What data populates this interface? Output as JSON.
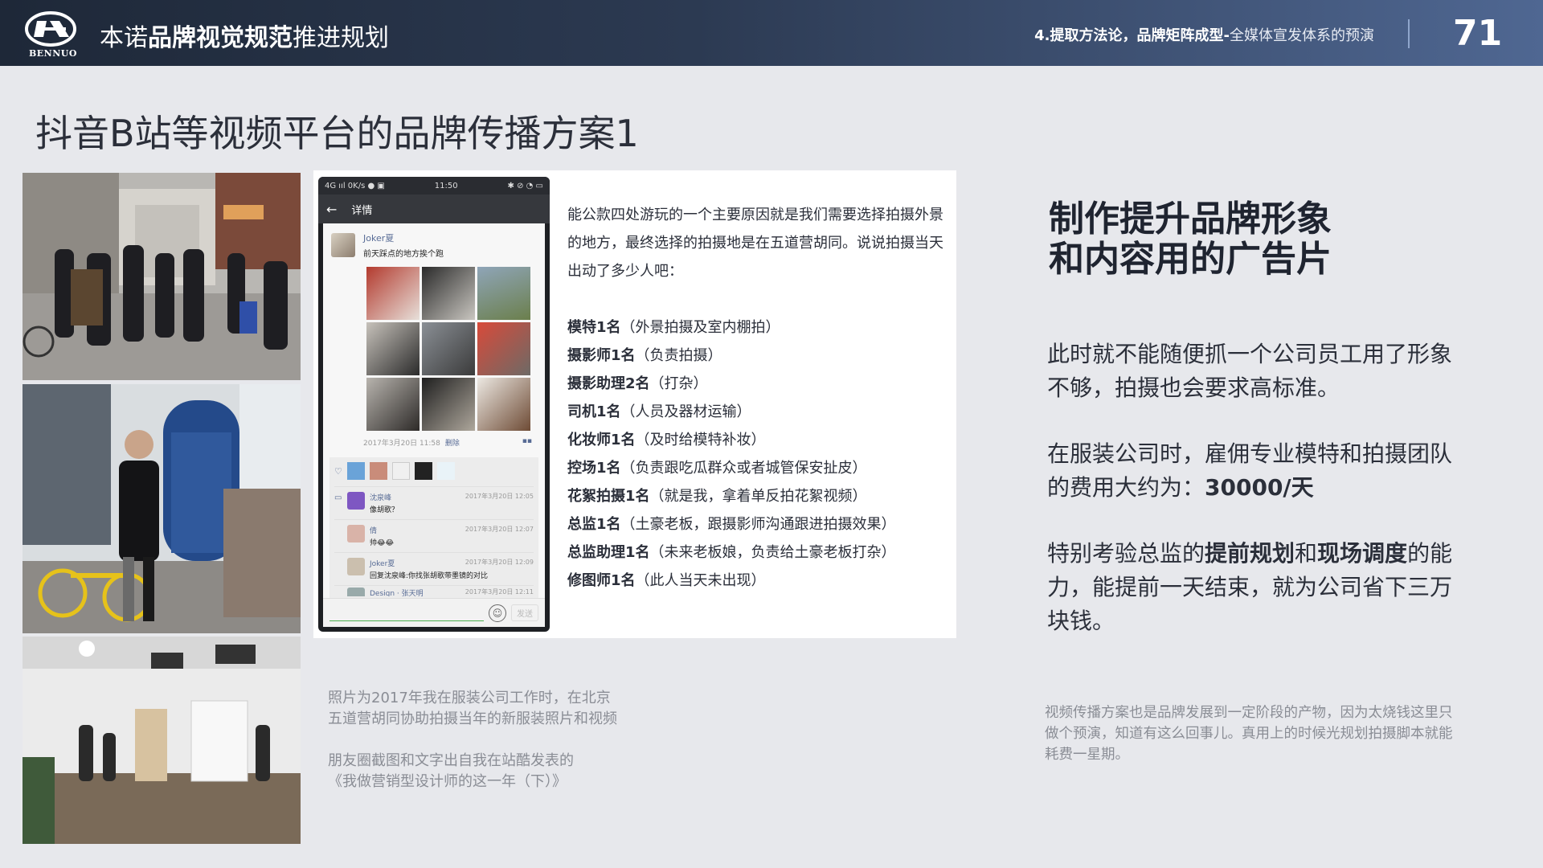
{
  "header": {
    "logo_text": "BENNUO",
    "title_prefix": "本诺",
    "title_bold": "品牌视觉规范",
    "title_suffix": "推进规划",
    "section_bold": "4.提取方法论，品牌矩阵成型-",
    "section_rest": "全媒体宣发体系的预演",
    "page_number": "71"
  },
  "page_title": "抖音B站等视频平台的品牌传播方案1",
  "phone": {
    "status_left": "4G ııl  0K/s ● ▣",
    "status_time": "11:50",
    "status_right": "✱ ⊘ ◔ ▭",
    "nav_title": "详情",
    "post_name": "Joker夏",
    "post_text": "前天踩点的地方挨个跑",
    "post_time": "2017年3月20日 11:58",
    "post_delete": "删除",
    "comments": [
      {
        "name": "沈泉峰",
        "text": "像胡歌？",
        "time": "2017年3月20日 12:05"
      },
      {
        "name": "倩",
        "text": "帅😂😂",
        "time": "2017年3月20日 12:07"
      },
      {
        "name": "Joker夏",
        "text": "回复沈泉峰:你找张胡歌带墨镜的对比",
        "time": "2017年3月20日 12:09"
      },
      {
        "name": "Design · 张天明",
        "text": "",
        "time": "2017年3月20日 12:11"
      }
    ],
    "send_label": "发送"
  },
  "story": {
    "intro": "能公款四处游玩的一个主要原因就是我们需要选择拍摄外景的地方，最终选择的拍摄地是在五道营胡同。说说拍摄当天出动了多少人吧：",
    "roles": [
      {
        "role": "模特1名",
        "note": "（外景拍摄及室内棚拍）"
      },
      {
        "role": "摄影师1名",
        "note": "（负责拍摄）"
      },
      {
        "role": "摄影助理2名",
        "note": "（打杂）"
      },
      {
        "role": "司机1名",
        "note": "（人员及器材运输）"
      },
      {
        "role": "化妆师1名",
        "note": "（及时给模特补妆）"
      },
      {
        "role": "控场1名",
        "note": "（负责跟吃瓜群众或者城管保安扯皮）"
      },
      {
        "role": "花絮拍摄1名",
        "note": "（就是我，拿着单反拍花絮视频）"
      },
      {
        "role": "总监1名",
        "note": "（土豪老板，跟摄影师沟通跟进拍摄效果）"
      },
      {
        "role": "总监助理1名",
        "note": "（未来老板娘，负责给土豪老板打杂）"
      },
      {
        "role": "修图师1名",
        "note": "（此人当天未出现）"
      }
    ]
  },
  "caption": {
    "line1": "照片为2017年我在服装公司工作时，在北京",
    "line2": "五道营胡同协助拍摄当年的新服装照片和视频",
    "line3": "朋友圈截图和文字出自我在站酷发表的",
    "line4": "《我做营销型设计师的这一年（下）》"
  },
  "right": {
    "heading_line1": "制作提升品牌形象",
    "heading_line2": "和内容用的广告片",
    "para1": "此时就不能随便抓一个公司员工用了形象不够，拍摄也会要求高标准。",
    "para2_text": "在服装公司时，雇佣专业模特和拍摄团队的费用大约为：",
    "para2_bold": "30000/天",
    "para3_a": "特别考验总监的",
    "para3_b": "提前规划",
    "para3_c": "和",
    "para3_d": "现场调度",
    "para3_e": "的能力，能提前一天结束，就为公司省下三万块钱。",
    "footnote": "视频传播方案也是品牌发展到一定阶段的产物，因为太烧钱这里只做个预演，知道有这么回事儿。真用上的时候光规划拍摄脚本就能耗费一星期。"
  }
}
